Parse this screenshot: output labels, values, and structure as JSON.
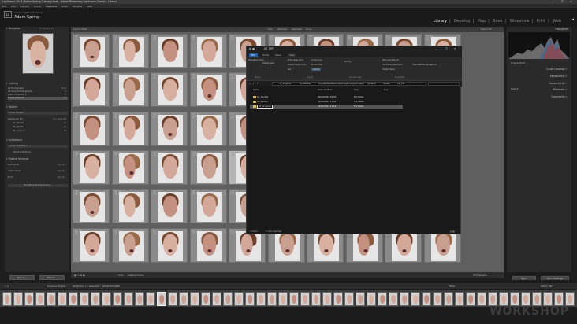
{
  "window": {
    "title": "Lightroom 2024 (Adam Spring) Catalog.lrcat - Adobe Photoshop Lightroom Classic - Library",
    "controls": [
      "–",
      "☐",
      "✕"
    ]
  },
  "menu": [
    "File",
    "Edit",
    "Library",
    "Photo",
    "Metadata",
    "View",
    "Window",
    "Help"
  ],
  "identity": {
    "logo": "Lr",
    "catalog": "Adobe Lightroom Classic",
    "user": "Adam Spring"
  },
  "modules": [
    {
      "label": "Library",
      "active": true
    },
    {
      "label": "Develop",
      "active": false
    },
    {
      "label": "Map",
      "active": false
    },
    {
      "label": "Book",
      "active": false
    },
    {
      "label": "Slideshow",
      "active": false
    },
    {
      "label": "Print",
      "active": false
    },
    {
      "label": "Web",
      "active": false
    }
  ],
  "left_panel": {
    "navigator": {
      "header": "Navigator",
      "zoom": "FIT  FILL  1:1  3:1"
    },
    "catalog": {
      "header": "Catalog",
      "items": [
        {
          "label": "All Photographs",
          "count": "7024"
        },
        {
          "label": "All Synced Photographs",
          "count": "0"
        },
        {
          "label": "Quick Collection +",
          "count": "0"
        },
        {
          "label": "Previous Import",
          "count": "84"
        }
      ]
    },
    "folders": {
      "header": "Folders",
      "items": [
        {
          "label": "+ Filter Folders"
        },
        {
          "label": "Games Pro (E:)",
          "count": "22 / 1024 GB"
        },
        {
          "label": "01_Neutral",
          "count": "23"
        },
        {
          "label": "02_Stretch",
          "count": "23"
        },
        {
          "label": "03_Cropped",
          "count": "38"
        }
      ]
    },
    "collections": {
      "header": "Collections",
      "items": [
        {
          "label": "+ Filter Collections"
        },
        {
          "label": "Smart Collections"
        }
      ]
    },
    "publish": {
      "header": "Publish Services",
      "items": [
        {
          "label": "Hard Drive",
          "count": "Set Up..."
        },
        {
          "label": "Adobe Stock",
          "count": "Set Up..."
        },
        {
          "label": "Flickr",
          "count": "Set Up..."
        },
        {
          "label": "Find More Services Online..."
        }
      ]
    },
    "import_label": "Import...",
    "export_label": "Export..."
  },
  "filter_bar": {
    "title": "Library Filter :",
    "options": [
      "Text",
      "Attribute",
      "Metadata",
      "None"
    ],
    "preset": "Filters Off"
  },
  "grid": {
    "numbers": [
      "1",
      "2",
      "3",
      "4",
      "5",
      "6",
      "7",
      "8",
      "9",
      "10",
      "11",
      "12",
      "13",
      "14",
      "15",
      "16",
      "17",
      "18",
      "19",
      "20",
      "21",
      "22",
      "23",
      "24",
      "25",
      "26",
      "27",
      "28",
      "29",
      "30",
      "31",
      "32",
      "33",
      "34",
      "35",
      "36",
      "37",
      "38",
      "39",
      "40",
      "41",
      "42",
      "43",
      "44",
      "45",
      "46",
      "47",
      "48",
      "49",
      "50",
      "51",
      "52",
      "53",
      "54",
      "55",
      "56",
      "57",
      "58",
      "59",
      "60"
    ]
  },
  "toolbar": {
    "sort_label": "Sort:",
    "sort_value": "Capture Time",
    "thumbnails_label": "Thumbnails"
  },
  "right_panel": {
    "histogram_label": "Histogram",
    "original_photo": "Original Photo",
    "sections": [
      "Quick Develop",
      "Keywording",
      "Keyword List",
      "Metadata",
      "Comments"
    ],
    "keyword_set": "Recent Keywords",
    "metadata_preset": "Default",
    "sync_label": "Sync",
    "sync_settings_label": "Sync Settings"
  },
  "bottom_bar": {
    "view": "1  2",
    "previous_import": "Previous Import",
    "count": "84 photos / 1 selected / _DSC6123.ARW",
    "filter_label": "Filter :",
    "filter_value": "Filters Off"
  },
  "watermark": "WORKSHOP",
  "explorer": {
    "title": "03_TIFF",
    "tabs": [
      "File",
      "Home",
      "Share",
      "View"
    ],
    "ribbon": {
      "layout_items": [
        "Extra large icons",
        "Large icons",
        "Medium-sized icons",
        "Small icons",
        "List",
        "Details"
      ],
      "navigation_pane": "Navigation pane",
      "details_pane": "Details pane",
      "sort_by": "Sort by",
      "item_checkboxes": "Item check boxes",
      "file_extensions": "File name extensions",
      "hidden_items": "Hidden items",
      "hide_selected": "Hide selected items",
      "options": "Options",
      "group_labels": [
        "Panes",
        "Layout",
        "Current view",
        "Show/hide"
      ]
    },
    "breadcrumb": [
      "07_Projects",
      "Downloads",
      "FaceAR/development/stringPhotogrammetry",
      "SOURCE",
      "SCANS",
      "03_TIFF"
    ],
    "search_placeholder": "Search 03_TIFF",
    "columns": [
      "Name",
      "Date modified",
      "Type",
      "Size"
    ],
    "rows": [
      {
        "name": "01_Neutral",
        "date": "04/02/2024 16:56",
        "type": "File folder",
        "size": "",
        "selected": false
      },
      {
        "name": "02_Stretch",
        "date": "04/02/2024 17:03",
        "type": "File folder",
        "size": "",
        "selected": false
      },
      {
        "name": "03_Cropped",
        "date": "04/02/2024 17:18",
        "type": "File folder",
        "size": "",
        "selected": true
      }
    ],
    "status_items": "3 items",
    "status_selected": "1 item selected"
  }
}
